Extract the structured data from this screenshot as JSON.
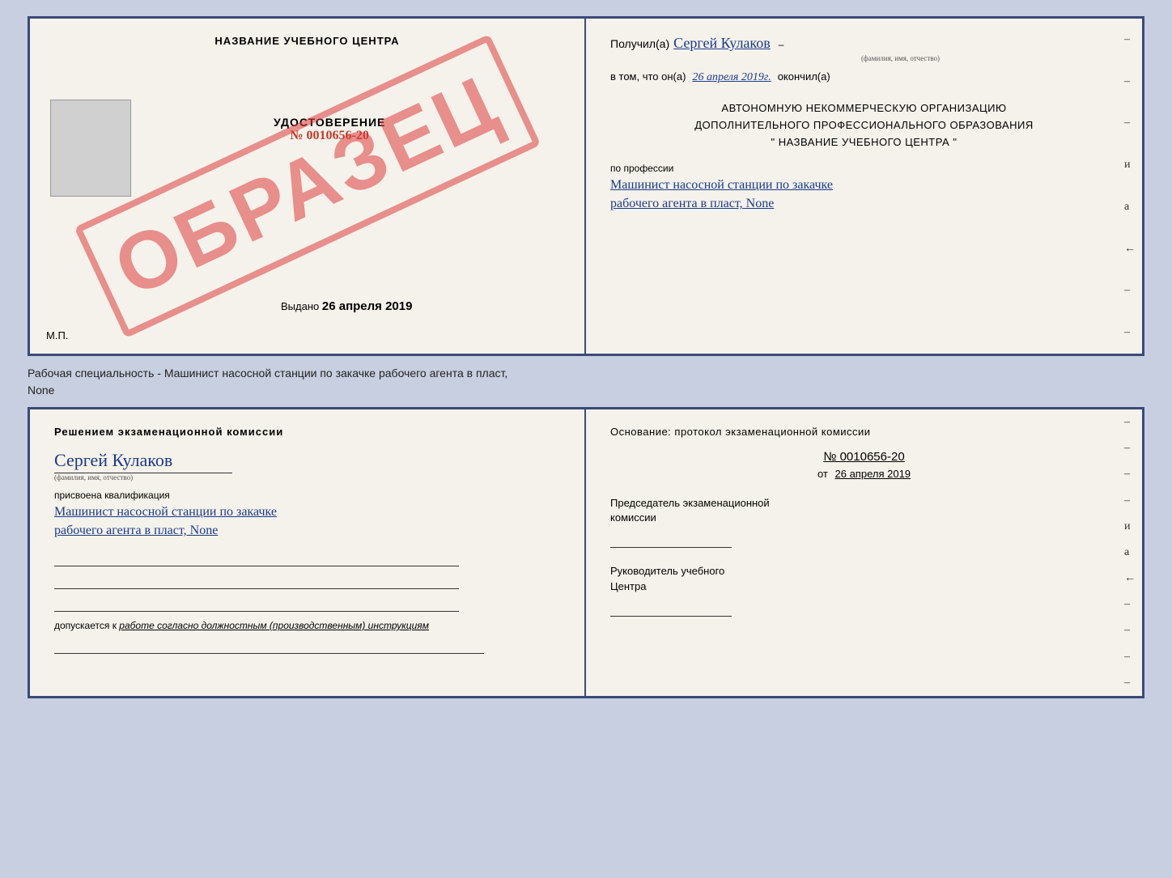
{
  "top_left": {
    "title": "НАЗВАНИЕ УЧЕБНОГО ЦЕНТРА",
    "obrazets": "ОБРАЗЕЦ",
    "udostoverenie_label": "УДОСТОВЕРЕНИЕ",
    "number": "№ 0010656-20",
    "vudano_label": "Выдано",
    "vudano_date": "26 апреля 2019",
    "mp": "М.П."
  },
  "top_right": {
    "received_label": "Получил(а)",
    "received_name": "Сергей Кулаков",
    "name_sublabel": "(фамилия, имя, отчество)",
    "date_prefix": "в том, что он(а)",
    "date_value": "26 апреля 2019г.",
    "date_suffix": "окончил(а)",
    "main_line1": "АВТОНОМНУЮ НЕКОММЕРЧЕСКУЮ ОРГАНИЗАЦИЮ",
    "main_line2": "ДОПОЛНИТЕЛЬНОГО ПРОФЕССИОНАЛЬНОГО ОБРАЗОВАНИЯ",
    "main_line3": "\"   НАЗВАНИЕ УЧЕБНОГО ЦЕНТРА   \"",
    "profession_label": "по профессии",
    "profession_line1": "Машинист насосной станции по закачке",
    "profession_line2": "рабочего агента в пласт, None",
    "dashes": [
      "-",
      "-",
      "-",
      "и",
      "а",
      "-",
      "-",
      "-"
    ]
  },
  "caption": {
    "text": "Рабочая специальность - Машинист насосной станции по закачке рабочего агента в пласт,",
    "text2": "None"
  },
  "bottom_left": {
    "commission_title": "Решением  экзаменационной  комиссии",
    "person_name": "Сергей Кулаков",
    "fio_label": "(фамилия, имя, отчество)",
    "assigned_text": "присвоена квалификация",
    "qualification_line1": "Машинист насосной станции по закачке",
    "qualification_line2": "рабочего агента в пласт, None",
    "допускается_prefix": "допускается к",
    "допускается_italic": "работе согласно должностным (производственным) инструкциям"
  },
  "bottom_right": {
    "osnovaniye": "Основание: протокол экзаменационной комиссии",
    "protocol_number": "№  0010656-20",
    "ot_label": "от",
    "ot_date": "26 апреля 2019",
    "predsedatel_line1": "Председатель экзаменационной",
    "predsedatel_line2": "комиссии",
    "rukovoditel_line1": "Руководитель учебного",
    "rukovoditel_line2": "Центра",
    "dashes": [
      "-",
      "-",
      "-",
      "-",
      "и",
      "а",
      "-",
      "-",
      "-",
      "-",
      "-"
    ]
  }
}
